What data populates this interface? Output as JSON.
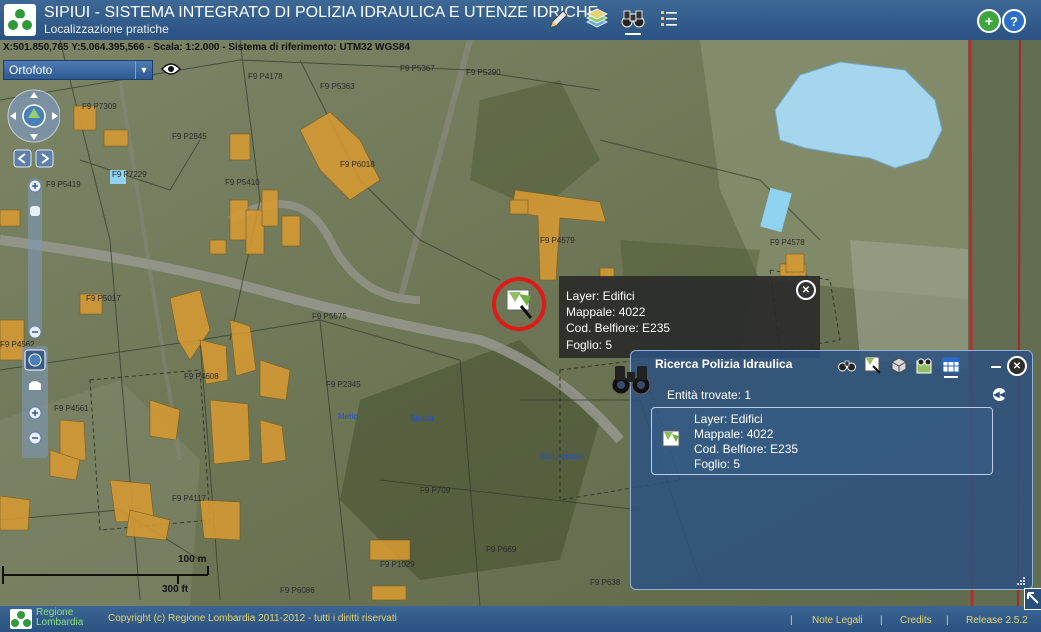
{
  "header": {
    "title": "SIPIUI - SISTEMA INTEGRATO DI POLIZIA IDRAULICA E UTENZE IDRICHE",
    "subtitle": "Localizzazione pratiche"
  },
  "map": {
    "coords": "X:501.850,765 Y:5.064.395,566 - Scala: 1:2.000 - Sistema di riferimento: UTM32 WGS84",
    "layer": "Ortofoto",
    "parcels": [
      "F9 P4178",
      "F9 P5363",
      "F9 P5367",
      "F9 P5290",
      "F9 P7309",
      "F9 P2845",
      "F9 P6018",
      "F9 P7229",
      "F9 P5419",
      "F9 P5410",
      "F9 P4579",
      "F9 P4578",
      "F9 P5017",
      "F9 P5575",
      "F9 P4608",
      "F9 P2345",
      "F9 P4561",
      "F9 P4117",
      "F9 P709",
      "F9 P669",
      "F9 P6086",
      "F9 P638",
      "F9 P1029",
      "F9 P4562"
    ],
    "streets": [
      "Strada",
      "Merlo",
      "Con sorziale"
    ],
    "scale_m": "100 m",
    "scale_ft": "300 ft"
  },
  "popup": {
    "layer": "Layer: Edifici",
    "mappale": "Mappale: 4022",
    "belfiore": "Cod. Belfiore: E235",
    "foglio": "Foglio: 5"
  },
  "panel": {
    "title": "Ricerca Polizia Idraulica",
    "entities": "Entità trovate: 1",
    "result": {
      "layer": "Layer: Edifici",
      "mappale": "Mappale: 4022",
      "belfiore": "Cod. Belfiore: E235",
      "foglio": "Foglio: 5"
    }
  },
  "footer": {
    "org_line1": "Regione",
    "org_line2": "Lombardia",
    "copyright": "Copyright (c) Regione Lombardia 2011-2012 - tutti i diritti riservati",
    "links": [
      "Note Legali",
      "Credits",
      "Release 2.5.2"
    ]
  }
}
